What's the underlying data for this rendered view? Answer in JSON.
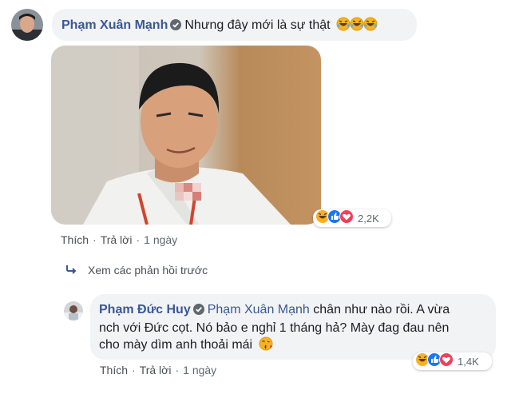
{
  "comment1": {
    "author": "Phạm Xuân Mạnh",
    "text": "Nhưng đây mới là sự thật",
    "emojis": [
      "laughing-crying-emoji",
      "laughing-crying-emoji",
      "laughing-crying-emoji"
    ],
    "reaction_count": "2,2K",
    "actions": {
      "like": "Thích",
      "reply": "Trả lời",
      "time": "1 ngày"
    }
  },
  "view_previous": "Xem các phản hồi trước",
  "reply1": {
    "author": "Phạm Đức Huy",
    "mention": "Phạm Xuân Mạnh",
    "line1": "chân như nào rồi. A vừa",
    "line2": "nch với Đức cọt. Nó bảo e nghỉ 1 tháng hả? Mày đag đau nên",
    "line3": "cho mày dìm anh thoải mái",
    "emoji": "kissing-emoji",
    "reaction_count": "1,4K",
    "actions": {
      "like": "Thích",
      "reply": "Trả lời",
      "time": "1 ngày"
    }
  },
  "colors": {
    "link": "#385898",
    "bubble": "#f2f3f5",
    "like_blue": "#1877f2",
    "love_red": "#f33e58",
    "haha_yellow": "#f7b125"
  }
}
